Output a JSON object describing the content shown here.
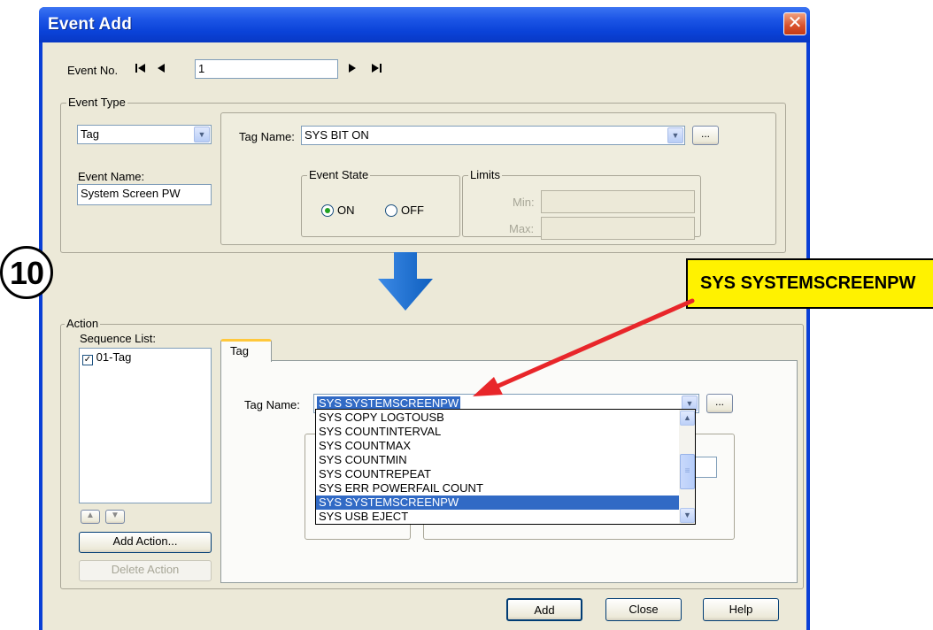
{
  "window": {
    "title": "Event Add",
    "close_symbol": "✕"
  },
  "event_no": {
    "label": "Event No.",
    "value": "1"
  },
  "event_type": {
    "legend": "Event Type",
    "type_value": "Tag",
    "event_name_label": "Event Name:",
    "event_name_value": "System Screen PW",
    "tag_name_label": "Tag Name:",
    "tag_name_value": "SYS BIT ON",
    "browse_label": "...",
    "event_state": {
      "legend": "Event State",
      "on_label": "ON",
      "off_label": "OFF",
      "selected": "ON"
    },
    "limits": {
      "legend": "Limits",
      "min_label": "Min:",
      "max_label": "Max:"
    }
  },
  "action": {
    "legend": "Action",
    "sequence_list_label": "Sequence List:",
    "sequence_items": [
      {
        "label": "01-Tag",
        "checked": true
      }
    ],
    "add_action_label": "Add Action...",
    "delete_action_label": "Delete Action",
    "tab_label": "Tag",
    "tag_name_label": "Tag Name:",
    "tag_name_value": "SYS SYSTEMSCREENPW",
    "browse_label": "...",
    "dropdown_items": [
      "SYS COPY LOGTOUSB",
      "SYS COUNTINTERVAL",
      "SYS COUNTMAX",
      "SYS COUNTMIN",
      "SYS COUNTREPEAT",
      "SYS ERR POWERFAIL COUNT",
      "SYS SYSTEMSCREENPW",
      "SYS USB EJECT"
    ],
    "dropdown_selected_index": 6
  },
  "footer": {
    "add_label": "Add",
    "close_label": "Close",
    "help_label": "Help"
  },
  "annotations": {
    "step_number": "10",
    "callout_text": "SYS SYSTEMSCREENPW"
  },
  "colors": {
    "titlebar": "#0a42d8",
    "dialog_face": "#ece9d8",
    "selection": "#316ac5",
    "callout_fill": "#fff200",
    "arrow_red": "#e8262a",
    "arrow_blue": "#1a6fd0"
  },
  "icons": {
    "first_record": "first-record-icon",
    "prev_record": "prev-record-icon",
    "next_record": "next-record-icon",
    "last_record": "last-record-icon",
    "move_up": "move-up-icon",
    "move_down": "move-down-icon"
  }
}
